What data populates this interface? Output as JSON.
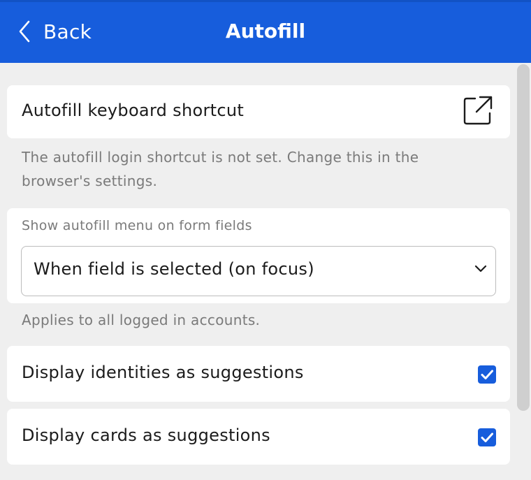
{
  "header": {
    "back_label": "Back",
    "title": "Autofill",
    "accent_color": "#175ddc"
  },
  "shortcut": {
    "label": "Autofill keyboard shortcut",
    "icon": "external-link-icon",
    "help_text": "The autofill login shortcut is not set. Change this in the browser's settings."
  },
  "autofill_menu": {
    "label": "Show autofill menu on form fields",
    "selected_value": "When field is selected (on focus)",
    "help_text": "Applies to all logged in accounts."
  },
  "options": [
    {
      "label": "Display identities as suggestions",
      "checked": true
    },
    {
      "label": "Display cards as suggestions",
      "checked": true
    }
  ]
}
